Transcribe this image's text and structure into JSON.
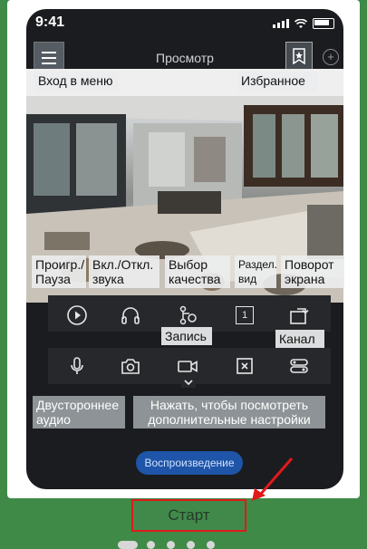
{
  "status_bar": {
    "time": "9:41"
  },
  "header": {
    "title": "Просмотр"
  },
  "tooltips": {
    "menu": "Вход в меню",
    "favorites": "Избранное",
    "play_pause": "Проигр./\nПауза",
    "sound": "Вкл./Откл.\nзвука",
    "quality": "Выбор\nкачества",
    "split": "Раздел.\nвид",
    "rotate": "Поворот\nэкрана",
    "record": "Запись",
    "channel": "Канал",
    "two_way_audio": "Двустороннее\nаудио",
    "more_settings": "Нажать, чтобы посмотреть\nдополнительные настройки"
  },
  "controls": {
    "split_num": "1"
  },
  "playback_button": "Воспроизведение",
  "start_button": "Старт",
  "colors": {
    "background": "#3f8a47",
    "highlight": "#e01a1a",
    "playback_blue": "#1f55a8"
  },
  "pager": {
    "count": 5
  }
}
